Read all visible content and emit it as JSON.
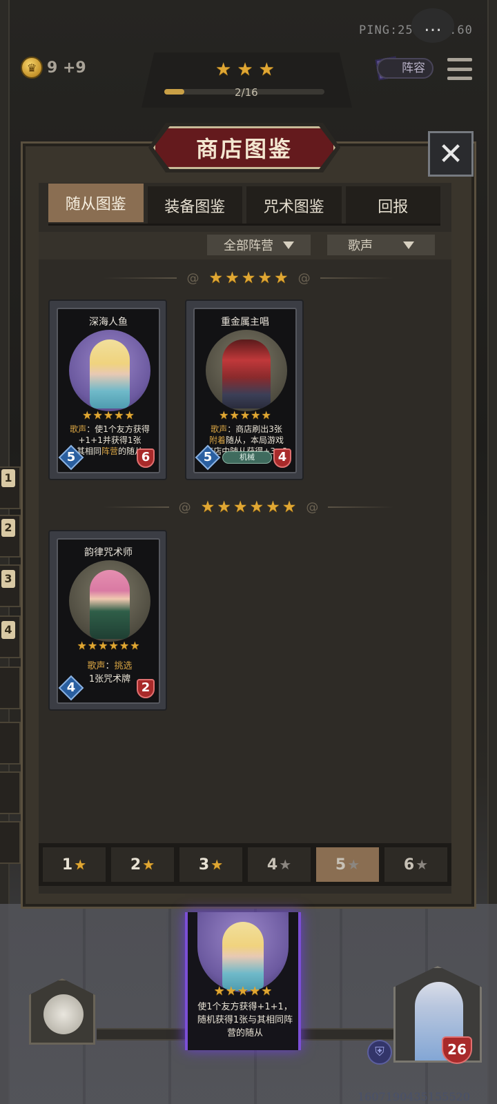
{
  "hud": {
    "ping": "PING:25",
    "timer": "1:60",
    "gold": "9 +9",
    "round_stars": 3,
    "progress_label": "2/16",
    "progress_fraction": 0.125,
    "lineup_label": "阵容"
  },
  "side_slots": [
    "1",
    "2",
    "3",
    "4"
  ],
  "modal": {
    "title": "商店图鉴",
    "tabs": [
      {
        "label": "随从图鉴",
        "active": true
      },
      {
        "label": "装备图鉴",
        "active": false
      },
      {
        "label": "咒术图鉴",
        "active": false
      },
      {
        "label": "回报",
        "active": false
      }
    ],
    "filters": {
      "faction": "全部阵营",
      "keyword": "歌声"
    },
    "tier5": {
      "stars": 5,
      "cards": [
        {
          "name": "深海人鱼",
          "stars": 5,
          "desc_kw": "歌声",
          "desc_1": "：使1个友方获得",
          "desc_2": "+1+1并获得1张",
          "desc_3_a": "其相同",
          "desc_3_kw": "阵营",
          "desc_3_b": "的随从",
          "attack": "5",
          "health": "6"
        },
        {
          "name": "重金属主唱",
          "stars": 5,
          "desc_kw": "歌声",
          "desc_1": "：商店刷出3张",
          "desc_2_kw": "附着",
          "desc_2": "随从，本局游戏",
          "desc_3": "商店中随从获得+3+3",
          "tribe": "机械",
          "attack": "5",
          "health": "4"
        }
      ]
    },
    "tier6": {
      "stars": 6,
      "cards": [
        {
          "name": "韵律咒术师",
          "stars": 6,
          "desc_kw": "歌声",
          "desc_1": "：",
          "desc_1_kw": "挑选",
          "desc_2": "1张咒术牌",
          "attack": "4",
          "health": "2"
        }
      ]
    },
    "levels": [
      {
        "label": "1",
        "active": false,
        "dim": false
      },
      {
        "label": "2",
        "active": false,
        "dim": false
      },
      {
        "label": "3",
        "active": false,
        "dim": false
      },
      {
        "label": "4",
        "active": false,
        "dim": true
      },
      {
        "label": "5",
        "active": true,
        "dim": true
      },
      {
        "label": "6",
        "active": false,
        "dim": true
      }
    ]
  },
  "preview": {
    "desc": "使1个友方获得+1+1，随机获得1张与其相同阵营的随从",
    "stars": 5
  },
  "hero": {
    "health": "26"
  },
  "footer": {
    "seed": "1607190435155520"
  },
  "colors": {
    "gold_star": "#e0a733",
    "keyword": "#d8a443",
    "attack_gem": "#2a5fa0",
    "health_gem": "#a82a2a",
    "active_tab": "#8a6e52",
    "title_plate": "#641a1d"
  }
}
